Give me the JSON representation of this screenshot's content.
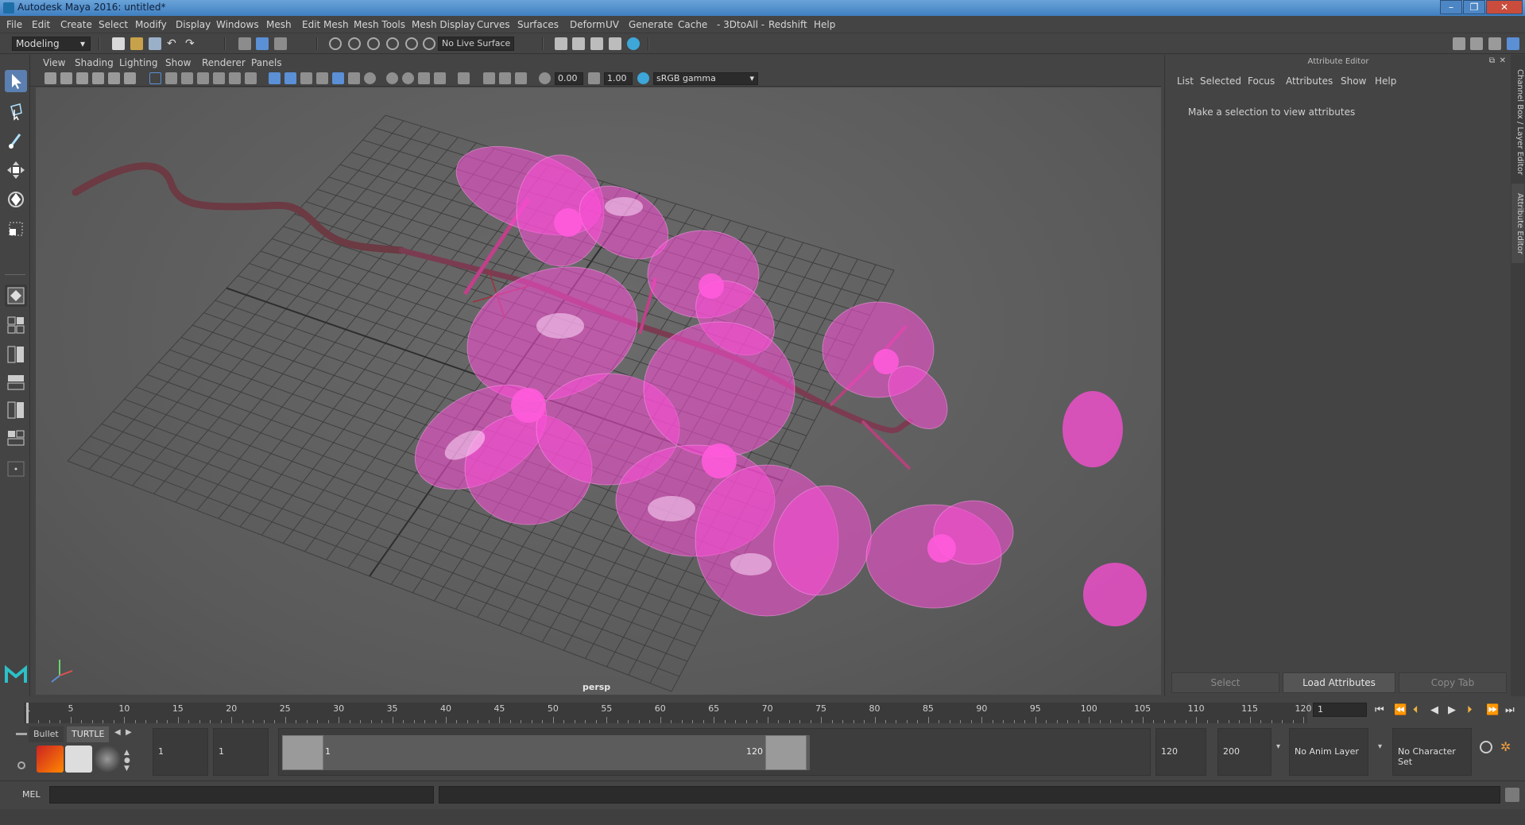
{
  "window": {
    "title": "Autodesk Maya 2016: untitled*"
  },
  "menu": [
    "File",
    "Edit",
    "Create",
    "Select",
    "Modify",
    "Display",
    "Windows",
    "Mesh",
    "Edit Mesh",
    "Mesh Tools",
    "Mesh Display",
    "Curves",
    "Surfaces",
    "Deform",
    "UV",
    "Generate",
    "Cache",
    "- 3DtoAll -",
    "Redshift",
    "Help"
  ],
  "status": {
    "mode": "Modeling",
    "live_surface": "No Live Surface"
  },
  "panel_menu": [
    "View",
    "Shading",
    "Lighting",
    "Show",
    "Renderer",
    "Panels"
  ],
  "panel_fields": {
    "exposure": "0.00",
    "gamma": "1.00",
    "color_space": "sRGB gamma"
  },
  "viewport": {
    "camera": "persp"
  },
  "attribute_editor": {
    "title": "Attribute Editor",
    "menu": [
      "List",
      "Selected",
      "Focus",
      "Attributes",
      "Show",
      "Help"
    ],
    "message": "Make a selection to view attributes",
    "buttons": {
      "select": "Select",
      "load": "Load Attributes",
      "copy": "Copy Tab"
    },
    "side_tabs": [
      "Channel Box / Layer Editor",
      "Attribute Editor"
    ]
  },
  "timeline": {
    "labels": [
      "1",
      "5",
      "10",
      "15",
      "20",
      "25",
      "30",
      "35",
      "40",
      "45",
      "50",
      "55",
      "60",
      "65",
      "70",
      "75",
      "80",
      "85",
      "90",
      "95",
      "100",
      "105",
      "110",
      "115",
      "120"
    ],
    "current_frame": "1"
  },
  "shelf": {
    "tabs": [
      "Bullet",
      "TURTLE"
    ]
  },
  "range": {
    "start": "1",
    "playback_start": "1",
    "range_start": "1",
    "range_end": "120",
    "playback_end": "120",
    "end": "200",
    "anim_layer": "No Anim Layer",
    "character_set": "No Character Set"
  },
  "command": {
    "label": "MEL"
  },
  "colors": {
    "accent": "#5b8fd6",
    "flower": "#ff4fd8",
    "stem": "#6b3a43"
  }
}
